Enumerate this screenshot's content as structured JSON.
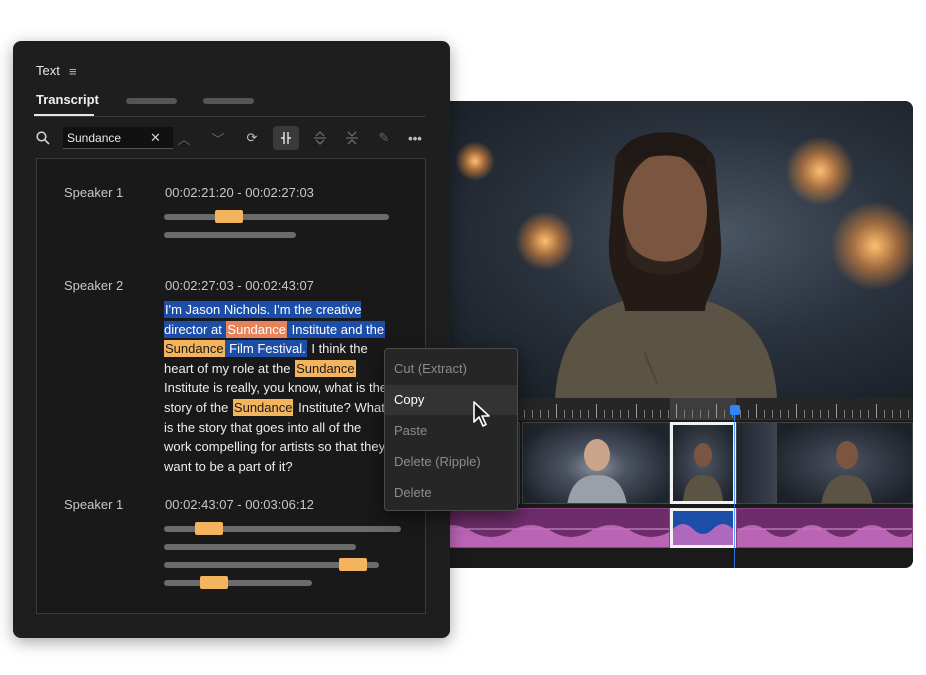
{
  "panel": {
    "title": "Text",
    "tabs": [
      {
        "label": "Transcript",
        "active": true
      }
    ]
  },
  "search": {
    "value": "Sundance",
    "placeholder": ""
  },
  "transcript": {
    "segments": [
      {
        "speaker": "Speaker 1",
        "timecode": "00:02:21:20 - 00:02:27:03"
      },
      {
        "speaker": "Speaker 2",
        "timecode": "00:02:27:03 - 00:02:43:07",
        "text_parts": [
          "I'm Jason Nichols. I'm the creative director at ",
          "Sundance",
          " Institute and the ",
          "Sundance",
          " Film Festival.",
          " I think the heart of my role at the ",
          "Sundance",
          " Institute is really, you know, what is the story of the ",
          "Sundance",
          " Institute? What is the story that goes into all of the work compelling for artists so that they want to be a part of it?"
        ]
      },
      {
        "speaker": "Speaker 1",
        "timecode": "00:02:43:07 - 00:03:06:12"
      }
    ]
  },
  "context_menu": {
    "items": [
      {
        "label": "Cut (Extract)",
        "enabled": false
      },
      {
        "label": "Copy",
        "enabled": true,
        "hovered": true
      },
      {
        "label": "Paste",
        "enabled": false
      },
      {
        "label": "Delete (Ripple)",
        "enabled": false
      },
      {
        "label": "Delete",
        "enabled": false
      }
    ]
  },
  "icons": {
    "panel_menu": "hamburger-icon",
    "search": "search-icon",
    "clear": "close-icon",
    "toolbar": [
      "chevron-up-icon",
      "chevron-down-icon",
      "refresh-icon",
      "split-icon",
      "expand-icon",
      "collapse-icon",
      "pencil-icon",
      "more-icon"
    ]
  },
  "colors": {
    "selection": "#1c4ea8",
    "search_match": "#f4b45e",
    "playhead": "#2f86ff",
    "audio_clip": "#6e2d6a"
  }
}
